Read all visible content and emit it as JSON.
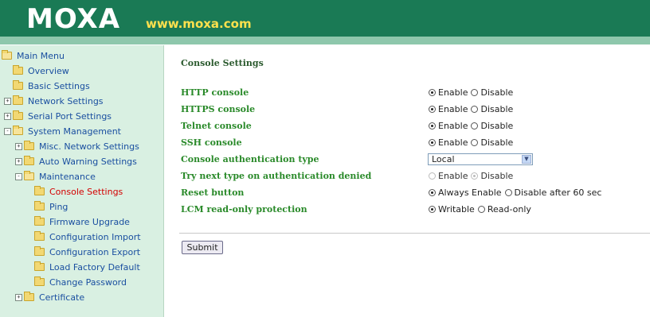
{
  "header": {
    "logo": "MOXA",
    "url": "www.moxa.com",
    "colors": {
      "banner": "#1a7a55",
      "url_text": "#ffe14d"
    }
  },
  "sidebar": {
    "items": [
      {
        "label": "Main Menu",
        "expander": ""
      },
      {
        "label": "Overview",
        "expander": ""
      },
      {
        "label": "Basic Settings",
        "expander": ""
      },
      {
        "label": "Network Settings",
        "expander": "+"
      },
      {
        "label": "Serial Port Settings",
        "expander": "+"
      },
      {
        "label": "System Management",
        "expander": "-"
      },
      {
        "label": "Misc. Network Settings",
        "expander": "+"
      },
      {
        "label": "Auto Warning Settings",
        "expander": "+"
      },
      {
        "label": "Maintenance",
        "expander": "-"
      },
      {
        "label": "Console Settings",
        "expander": ""
      },
      {
        "label": "Ping",
        "expander": ""
      },
      {
        "label": "Firmware Upgrade",
        "expander": ""
      },
      {
        "label": "Configuration Import",
        "expander": ""
      },
      {
        "label": "Configuration Export",
        "expander": ""
      },
      {
        "label": "Load Factory Default",
        "expander": ""
      },
      {
        "label": "Change Password",
        "expander": ""
      },
      {
        "label": "Certificate",
        "expander": "+"
      }
    ],
    "active": "Console Settings",
    "colors": {
      "background": "#d9f0e2",
      "link": "#1a4fa0",
      "active": "#d40000"
    }
  },
  "content": {
    "title": "Console Settings",
    "rows": [
      {
        "label": "HTTP console",
        "options": [
          "Enable",
          "Disable"
        ],
        "selected": "Enable"
      },
      {
        "label": "HTTPS console",
        "options": [
          "Enable",
          "Disable"
        ],
        "selected": "Enable"
      },
      {
        "label": "Telnet console",
        "options": [
          "Enable",
          "Disable"
        ],
        "selected": "Enable"
      },
      {
        "label": "SSH console",
        "options": [
          "Enable",
          "Disable"
        ],
        "selected": "Enable"
      },
      {
        "label": "Console authentication type",
        "select_value": "Local"
      },
      {
        "label": "Try next type on authentication denied",
        "options": [
          "Enable",
          "Disable"
        ],
        "selected": "Disable",
        "disabled": true
      },
      {
        "label": "Reset button",
        "options": [
          "Always Enable",
          "Disable after 60 sec"
        ],
        "selected": "Always Enable"
      },
      {
        "label": "LCM read-only protection",
        "options": [
          "Writable",
          "Read-only"
        ],
        "selected": "Writable"
      }
    ],
    "submit_label": "Submit",
    "colors": {
      "title": "#2b5a2e",
      "label": "#2a8a2a"
    }
  }
}
